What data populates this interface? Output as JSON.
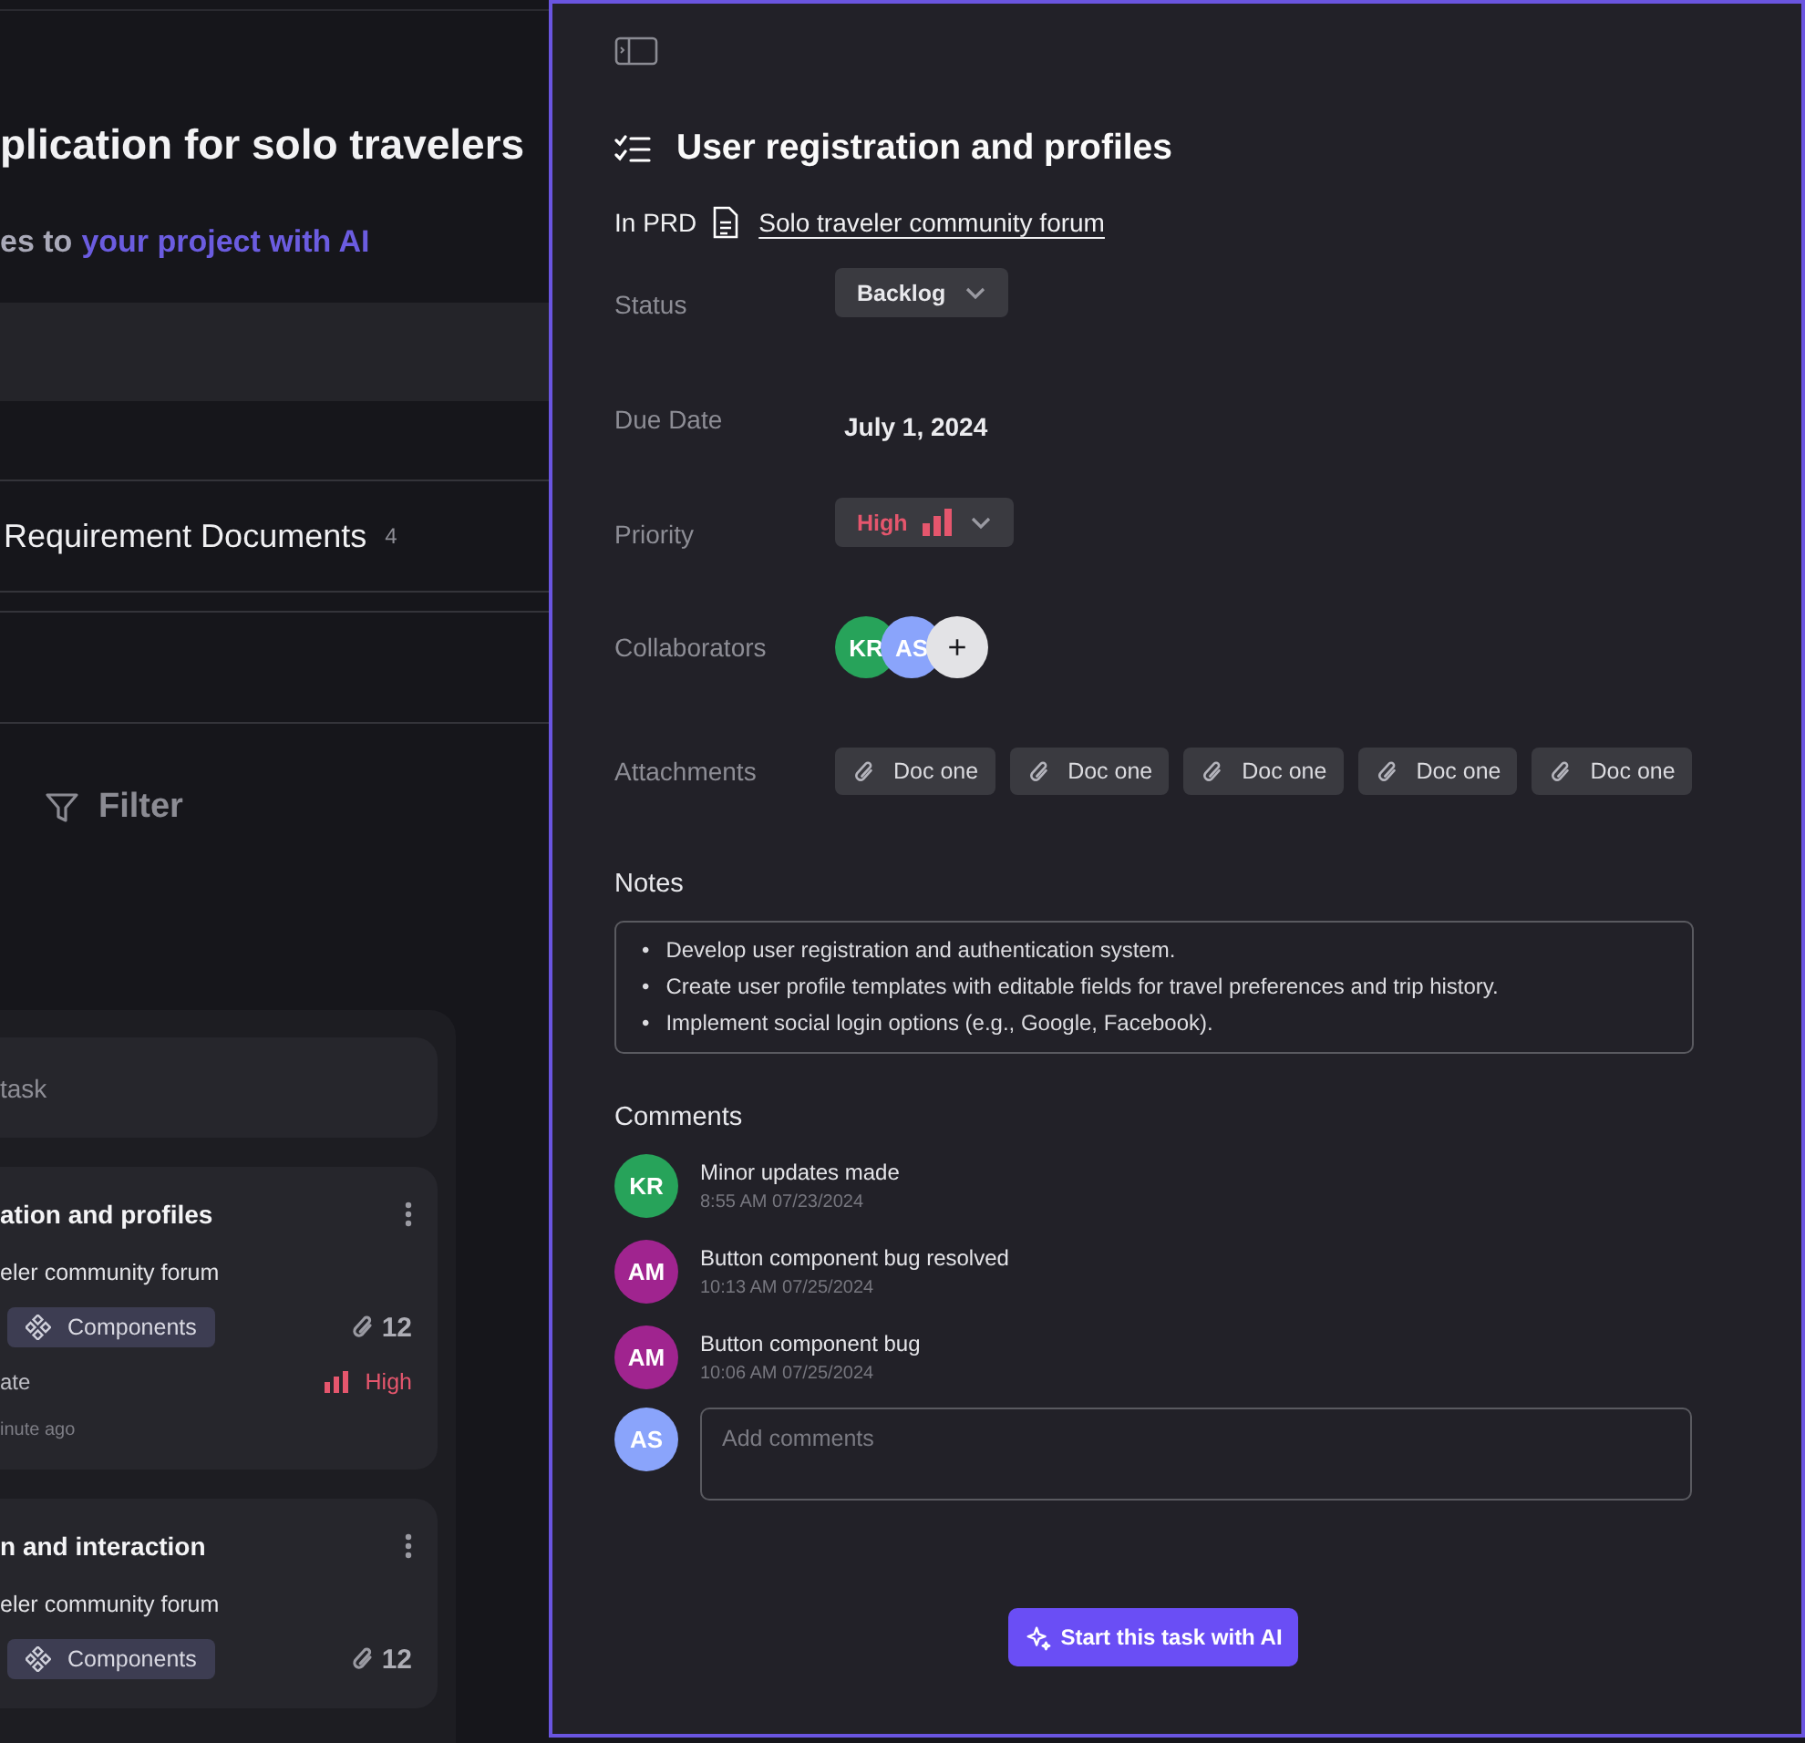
{
  "background": {
    "title": "plication for solo travelers",
    "subtitle_prefix": "es to",
    "subtitle_link": "your project with AI",
    "section": {
      "title": "Requirement Documents",
      "count": "4"
    },
    "filter": "Filter",
    "column": {
      "add_task": "task",
      "cards": [
        {
          "title": "ation and profiles",
          "prd": "eler community forum",
          "tag": "Components",
          "attachments": "12",
          "status": "ate",
          "priority": "High",
          "updated": "inute ago"
        },
        {
          "title": "n and interaction",
          "prd": "eler community forum",
          "tag": "Components",
          "attachments": "12"
        }
      ]
    }
  },
  "task": {
    "title": "User registration and profiles",
    "prd_label": "In PRD",
    "prd_link": "Solo traveler community forum",
    "fields": [
      {
        "kind": "dropdown",
        "label": "Status",
        "value": "Backlog"
      },
      {
        "kind": "date",
        "label": "Due Date",
        "value": "July 1, 2024"
      },
      {
        "kind": "priority",
        "label": "Priority",
        "value": "High"
      },
      {
        "kind": "people",
        "label": "Collaborators",
        "people": [
          {
            "initials": "KR",
            "color": "#27a35a"
          },
          {
            "initials": "AS",
            "color": "#8aa4fb"
          }
        ],
        "add": "+"
      },
      {
        "kind": "attachments",
        "label": "Attachments",
        "files": [
          "Doc one",
          "Doc one",
          "Doc one",
          "Doc one",
          "Doc one"
        ]
      }
    ],
    "notes_title": "Notes",
    "notes": [
      {
        "bullet": "•",
        "text": "Develop user registration and authentication system."
      },
      {
        "bullet": "•",
        "text": "Create user profile templates with editable fields for travel preferences and trip history."
      },
      {
        "bullet": "•",
        "text": "Implement social login options (e.g., Google, Facebook)."
      }
    ],
    "comments_title": "Comments",
    "comments": [
      {
        "initials": "KR",
        "color": "#27a35a",
        "text": "Minor updates made",
        "time": "8:55 AM 07/23/2024"
      },
      {
        "initials": "AM",
        "color": "#a0248f",
        "text": "Button component bug resolved",
        "time": "10:13 AM 07/25/2024"
      },
      {
        "initials": "AM",
        "color": "#a0248f",
        "text": "Button component bug",
        "time": "10:06 AM 07/25/2024"
      }
    ],
    "composer": {
      "initials": "AS",
      "color": "#8aa4fb",
      "placeholder": "Add comments"
    },
    "ai_button": "Start this task with AI"
  }
}
